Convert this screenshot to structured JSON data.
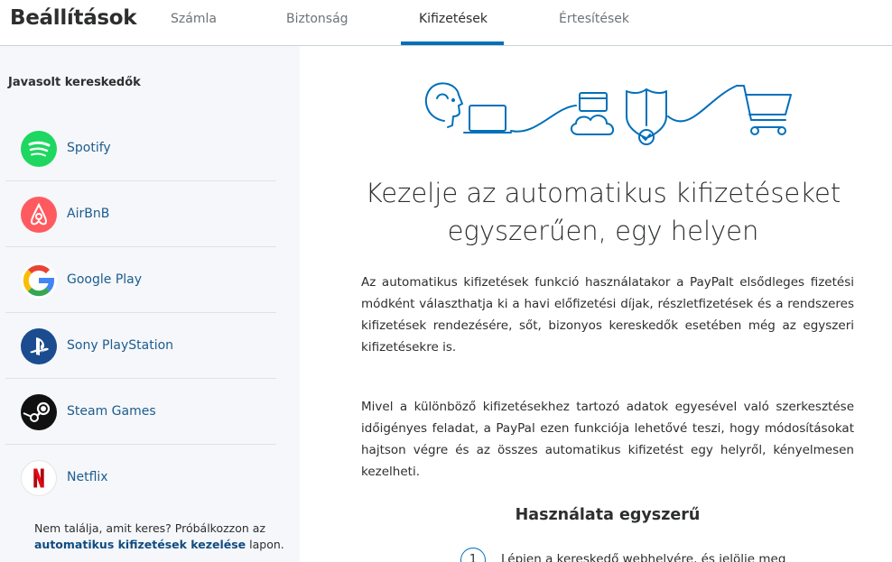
{
  "header": {
    "title": "Beállítások",
    "tabs": [
      {
        "label": "Számla"
      },
      {
        "label": "Biztonság"
      },
      {
        "label": "Kifizetések"
      },
      {
        "label": "Értesítések"
      }
    ],
    "active_tab": "Kifizetések"
  },
  "sidebar": {
    "title": "Javasolt kereskedők",
    "merchants": [
      {
        "name": "Spotify",
        "icon": "spotify-icon"
      },
      {
        "name": "AirBnB",
        "icon": "airbnb-icon"
      },
      {
        "name": "Google Play",
        "icon": "google-icon"
      },
      {
        "name": "Sony PlayStation",
        "icon": "playstation-icon"
      },
      {
        "name": "Steam Games",
        "icon": "steam-icon"
      },
      {
        "name": "Netflix",
        "icon": "netflix-icon"
      }
    ],
    "note_prefix": "Nem találja, amit keres? Próbálkozzon az",
    "note_link": "automatikus kifizetések kezelése",
    "note_suffix": "lapon."
  },
  "main": {
    "hero_icon": "automatic-payments-illustration",
    "headline_line1": "Kezelje az automatikus kifizetéseket",
    "headline_line2": "egyszerűen, egy helyen",
    "paragraph1": "Az automatikus kifizetések funkció használatakor a PayPalt elsődleges fizetési módként választhatja ki a havi előfizetési díjak, részletfizetések és a rendszeres kifizetések rendezésére, sőt, bizonyos kereskedők esetében még az egyszeri kifizetésekre is.",
    "paragraph2": "Mivel a különböző kifizetésekhez tartozó adatok egyesével való szerkesztése időigényes feladat, a PayPal ezen funkciója lehetővé teszi, hogy módosításokat hajtson végre és az összes automatikus kifizetést egy helyről, kényelmesen kezelheti.",
    "subheading": "Használata egyszerű",
    "steps": [
      {
        "number": "1",
        "text": "Lépjen a kereskedő webhelyére, és jelölje meg"
      }
    ]
  },
  "colors": {
    "accent": "#0070ba",
    "link": "#1d5c8e",
    "sidebar_bg": "#f5f7fa"
  }
}
